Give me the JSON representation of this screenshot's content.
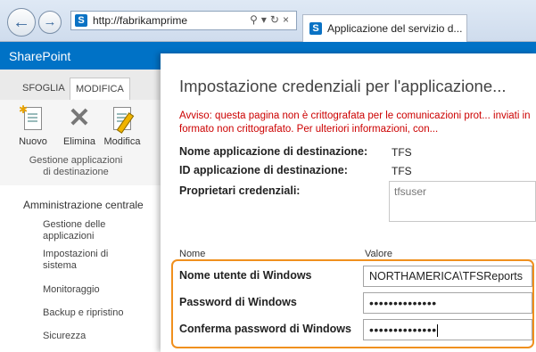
{
  "browser": {
    "url": "http://fabrikamprime",
    "tab_title": "Applicazione del servizio d..."
  },
  "sharepoint": {
    "title": "SharePoint",
    "brand_color": "#0072c6"
  },
  "ribbon": {
    "tabs": [
      "SFOGLIA",
      "MODIFICA"
    ],
    "buttons": {
      "new": "Nuovo",
      "delete": "Elimina",
      "edit": "Modifica"
    },
    "group_label": "Gestione applicazioni di destinazione"
  },
  "nav": {
    "heading": "Amministrazione centrale",
    "items": [
      "Gestione delle applicazioni",
      "Impostazioni di sistema",
      "Monitoraggio",
      "Backup e ripristino",
      "Sicurezza"
    ]
  },
  "dialog": {
    "title": "Impostazione credenziali per l'applicazione...",
    "warning": "Avviso: questa pagina non è crittografata per le comunicazioni prot... inviati in formato non crittografato. Per ulteriori informazioni, con...",
    "fields": {
      "target_app_name_label": "Nome applicazione di destinazione:",
      "target_app_name_value": "TFS",
      "target_app_id_label": "ID applicazione di destinazione:",
      "target_app_id_value": "TFS",
      "owners_label": "Proprietari credenziali:",
      "owners_value": "tfsuser"
    },
    "columns": {
      "name": "Nome",
      "value": "Valore"
    },
    "credentials": {
      "username_label": "Nome utente di Windows",
      "username_value": "NORTHAMERICA\\TFSReports",
      "password_label": "Password di Windows",
      "password_value": "••••••••••••••",
      "confirm_label": "Conferma password di Windows",
      "confirm_value": "••••••••••••••"
    },
    "highlight_color": "#f0901e",
    "warning_color": "#cc0000"
  },
  "icons": [
    "back-arrow-icon",
    "forward-arrow-icon",
    "sharepoint-icon",
    "search-icon",
    "refresh-icon",
    "new-document-icon",
    "delete-x-icon",
    "edit-document-icon"
  ]
}
